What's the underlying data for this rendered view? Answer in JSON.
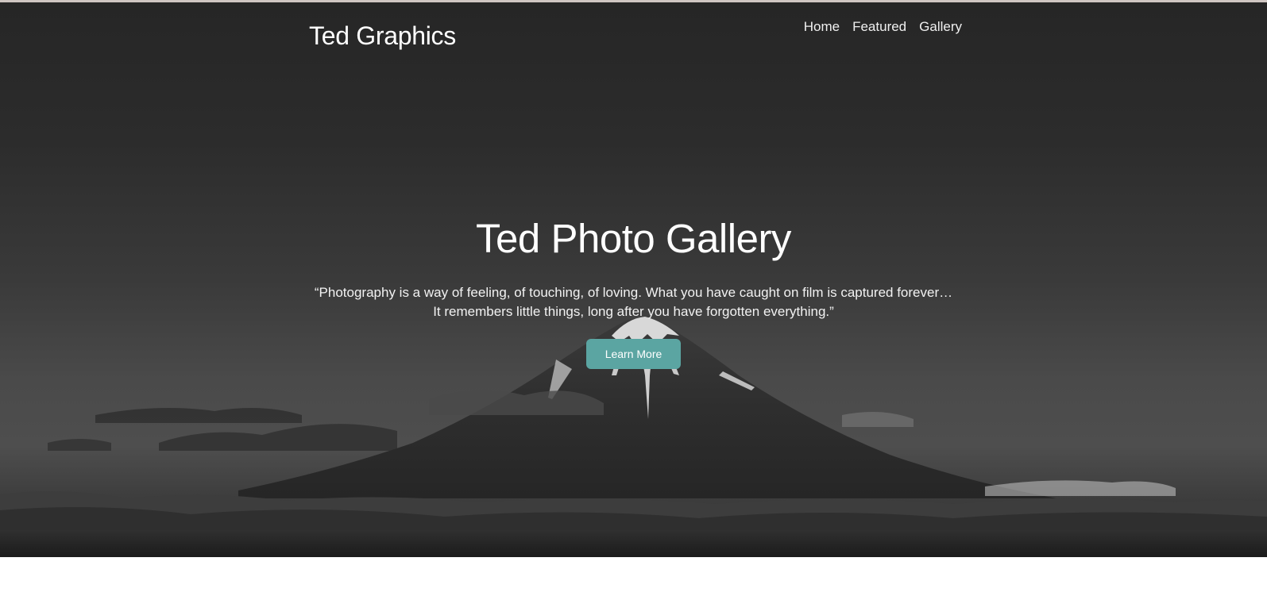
{
  "header": {
    "brand": "Ted Graphics",
    "nav": [
      {
        "label": "Home"
      },
      {
        "label": "Featured"
      },
      {
        "label": "Gallery"
      }
    ]
  },
  "hero": {
    "title": "Ted Photo Gallery",
    "quote_line_1": "“Photography is a way of feeling, of touching, of loving. What you have caught on film is captured forever…",
    "quote_line_2": "It remembers little things, long after you have forgotten everything.”",
    "cta_label": "Learn More",
    "background": "black-and-white photo of a snow-capped volcanic mountain above grassland and water"
  },
  "colors": {
    "accent": "#5ba5a2",
    "hero_overlay": "#2b2b2b",
    "text": "#ffffff"
  }
}
